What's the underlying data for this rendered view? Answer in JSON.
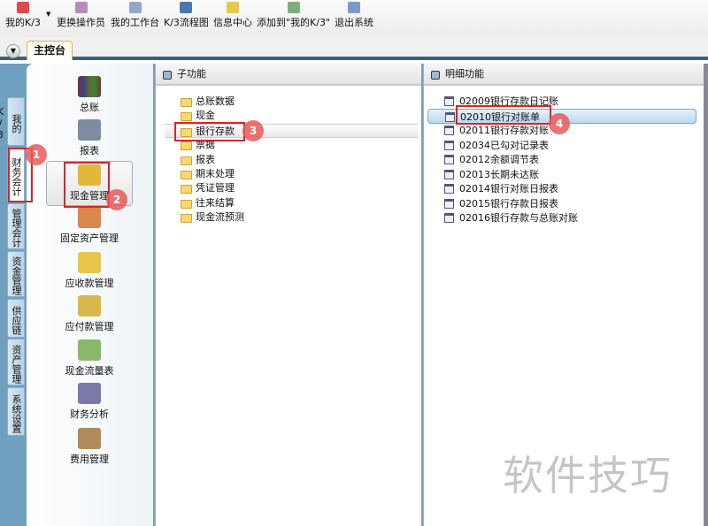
{
  "toolbar": {
    "items": [
      {
        "label": "我的K/3",
        "icon": "star-icon",
        "color": "#d94a4a"
      },
      {
        "label": "更换操作员",
        "icon": "users-icon",
        "color": "#b88ac0"
      },
      {
        "label": "我的工作台",
        "icon": "edit-icon",
        "color": "#8fa8c8"
      },
      {
        "label": "K/3流程图",
        "icon": "flowchart-icon",
        "color": "#4a78b0"
      },
      {
        "label": "信息中心",
        "icon": "chat-icon",
        "color": "#e6c84a"
      },
      {
        "label": "添加到\"我的K/3\"",
        "icon": "add-note-icon",
        "color": "#7ab07a"
      },
      {
        "label": "退出系统",
        "icon": "exit-icon",
        "color": "#7a9ac8"
      }
    ]
  },
  "tabs": {
    "main": "主控台"
  },
  "vtabs": [
    "我的K/3",
    "财务会计",
    "管理会计",
    "资金管理",
    "供应链",
    "资产管理",
    "系统设置"
  ],
  "modules": [
    "总账",
    "报表",
    "现金管理",
    "固定资产管理",
    "应收款管理",
    "应付款管理",
    "现金流量表",
    "财务分析",
    "费用管理"
  ],
  "sub": {
    "title": "子功能",
    "items": [
      "总账数据",
      "现金",
      "银行存款",
      "票据",
      "报表",
      "期末处理",
      "凭证管理",
      "往来结算",
      "现金流预测"
    ]
  },
  "detail": {
    "title": "明细功能",
    "items": [
      {
        "code": "02009",
        "name": "银行存款日记账"
      },
      {
        "code": "02010",
        "name": "银行对账单"
      },
      {
        "code": "02011",
        "name": "银行存款对账"
      },
      {
        "code": "02034",
        "name": "已勾对记录表"
      },
      {
        "code": "02012",
        "name": "余额调节表"
      },
      {
        "code": "02013",
        "name": "长期未达账"
      },
      {
        "code": "02014",
        "name": "银行对账日报表"
      },
      {
        "code": "02015",
        "name": "银行存款日报表"
      },
      {
        "code": "02016",
        "name": "银行存款与总账对账"
      }
    ]
  },
  "annotations": [
    "1",
    "2",
    "3",
    "4"
  ],
  "watermark": "软件技巧"
}
